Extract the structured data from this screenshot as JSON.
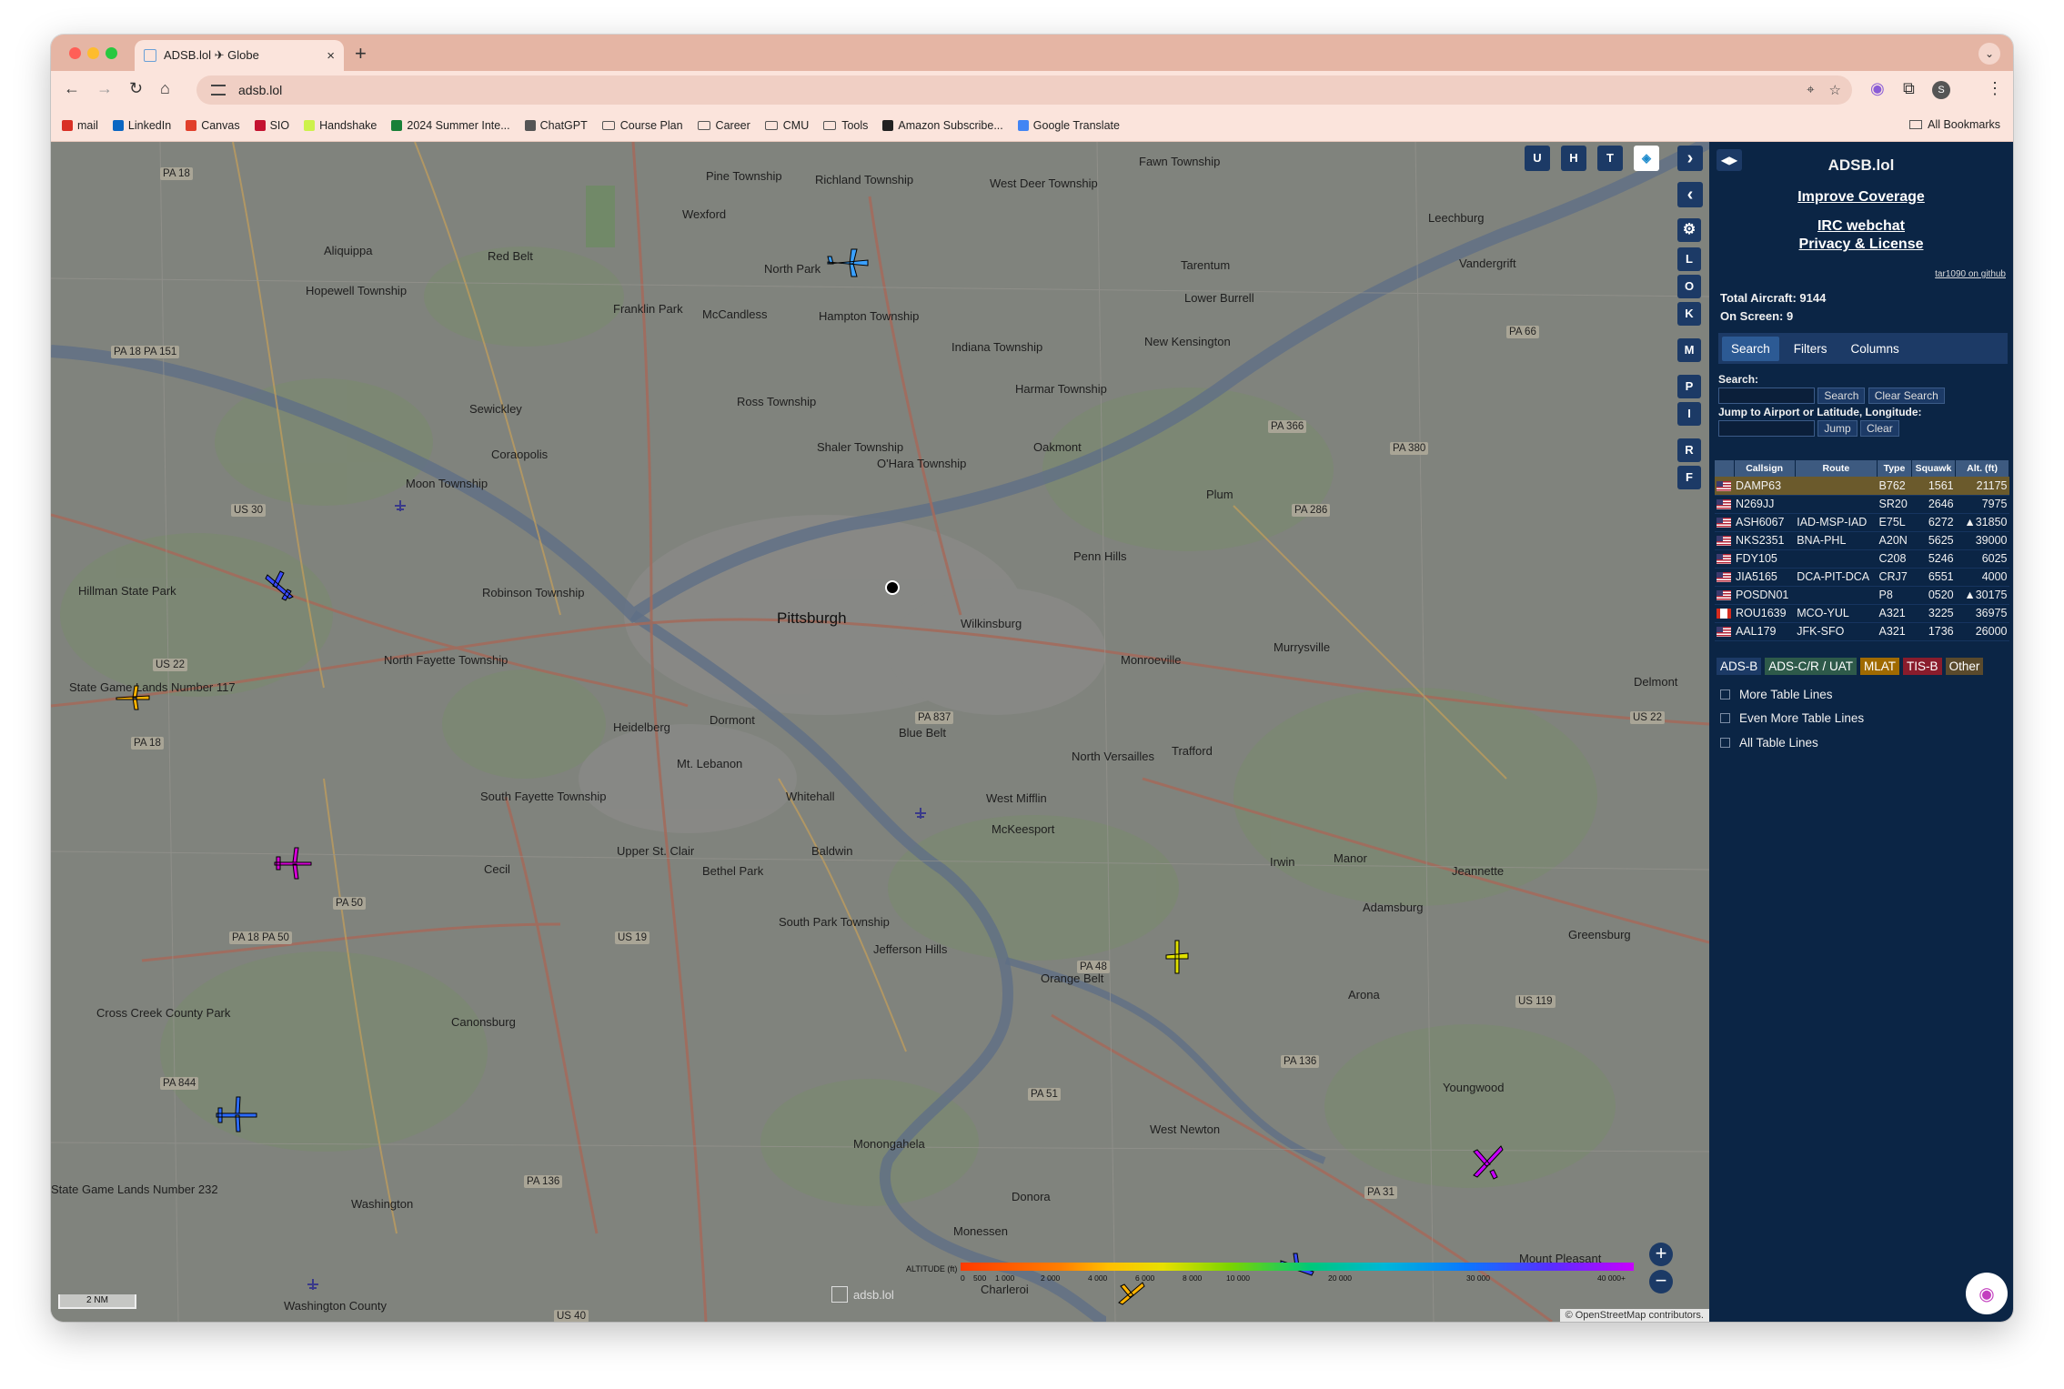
{
  "browser": {
    "tab_title": "ADSB.lol ✈ Globe",
    "tab_close": "×",
    "new_tab": "+",
    "url": "adsb.lol",
    "profile_initial": "S",
    "bookmarks": [
      {
        "label": "mail",
        "icon": "gmail-icon",
        "color": "#d93025"
      },
      {
        "label": "LinkedIn",
        "icon": "linkedin-icon",
        "color": "#0a66c2"
      },
      {
        "label": "Canvas",
        "icon": "canvas-icon",
        "color": "#e13f2b"
      },
      {
        "label": "SIO",
        "icon": "sio-icon",
        "color": "#c41230"
      },
      {
        "label": "Handshake",
        "icon": "handshake-icon",
        "color": "#cdf14a"
      },
      {
        "label": "2024 Summer Inte...",
        "icon": "sheets-icon",
        "color": "#188038"
      },
      {
        "label": "ChatGPT",
        "icon": "chatgpt-icon",
        "color": "#555555"
      },
      {
        "label": "Course Plan",
        "icon": "folder-icon",
        "color": ""
      },
      {
        "label": "Career",
        "icon": "folder-icon",
        "color": ""
      },
      {
        "label": "CMU",
        "icon": "folder-icon",
        "color": ""
      },
      {
        "label": "Tools",
        "icon": "folder-icon",
        "color": ""
      },
      {
        "label": "Amazon Subscribe...",
        "icon": "amazon-icon",
        "color": "#222222"
      },
      {
        "label": "Google Translate",
        "icon": "translate-icon",
        "color": "#4285f4"
      }
    ],
    "all_bookmarks": "All Bookmarks"
  },
  "map": {
    "top_buttons": [
      "U",
      "H",
      "T"
    ],
    "side_keys": [
      "L",
      "O",
      "K",
      "M",
      "P",
      "I",
      "R",
      "F"
    ],
    "labels": {
      "pittsburgh": "Pittsburgh",
      "places": [
        "Pine Township",
        "Richland Township",
        "West Deer Township",
        "Fawn Township",
        "Leechburg",
        "Wexford",
        "North Park",
        "Tarentum",
        "Vandergrift",
        "Aliquippa",
        "Red Belt",
        "Hopewell Township",
        "Franklin Park",
        "McCandless",
        "Hampton Township",
        "Lower Burrell",
        "Indiana Township",
        "New Kensington",
        "Harmar Township",
        "Ross Township",
        "Sewickley",
        "Coraopolis",
        "Shaler Township",
        "O'Hara Township",
        "Oakmont",
        "Moon Township",
        "Plum",
        "Penn Hills",
        "Hillman State Park",
        "Robinson Township",
        "Wilkinsburg",
        "Murrysville",
        "North Fayette Township",
        "Monroeville",
        "Delmont",
        "Heidelberg",
        "Dormont",
        "Mt. Lebanon",
        "Blue Belt",
        "North Versailles",
        "Trafford",
        "State Game Lands Number 117",
        "South Fayette Township",
        "Whitehall",
        "West Mifflin",
        "McKeesport",
        "Upper St. Clair",
        "Baldwin",
        "Bethel Park",
        "Irwin",
        "Manor",
        "Jeannette",
        "Cecil",
        "South Park Township",
        "Jefferson Hills",
        "Adamsburg",
        "Greensburg",
        "Orange Belt",
        "Cross Creek County Park",
        "Canonsburg",
        "Arona",
        "Youngwood",
        "West Newton",
        "Monongahela",
        "Washington",
        "Donora",
        "Monessen",
        "Charleroi",
        "Mount Pleasant",
        "State Game Lands Number 232",
        "Washington County"
      ],
      "routes": [
        "PA 18",
        "PA 18 PA 151",
        "US 30",
        "US 22",
        "PA 18",
        "PA 18 PA 50",
        "PA 50",
        "US 19",
        "PA 837",
        "PA 48",
        "PA 844",
        "PA 136",
        "US 40",
        "PA 51",
        "PA 136",
        "PA 31",
        "US 119",
        "US 22",
        "PA 66",
        "PA 366",
        "PA 380",
        "PA 286"
      ]
    },
    "legend": {
      "label": "ALTITUDE (ft)",
      "ticks": [
        "0",
        "500",
        "1 000",
        "2 000",
        "4 000",
        "6 000",
        "8 000",
        "10 000",
        "20 000",
        "30 000",
        "40 000+"
      ]
    },
    "scale": "2 NM",
    "watermark": "adsb.lol",
    "attribution": "© OpenStreetMap contributors.",
    "zoom_in": "+",
    "zoom_out": "−"
  },
  "panel": {
    "toggle": "◀▶",
    "title": "ADSB.lol",
    "links": [
      "Improve Coverage",
      "IRC webchat",
      "Privacy & License"
    ],
    "github": "tar1090 on github",
    "total_aircraft_label": "Total Aircraft:",
    "total_aircraft": "9144",
    "on_screen_label": "On Screen:",
    "on_screen": "9",
    "tabs": [
      "Search",
      "Filters",
      "Columns"
    ],
    "search_label": "Search:",
    "search_btn": "Search",
    "clear_search_btn": "Clear Search",
    "jump_label": "Jump to Airport or Latitude, Longitude:",
    "jump_btn": "Jump",
    "clear_btn": "Clear",
    "columns": [
      "Callsign",
      "Route",
      "Type",
      "Squawk",
      "Alt. (ft)"
    ],
    "rows": [
      {
        "flag": "us",
        "callsign": "DAMP63",
        "route": "",
        "type": "B762",
        "squawk": "1561",
        "alt": "21175",
        "selected": true
      },
      {
        "flag": "us",
        "callsign": "N269JJ",
        "route": "",
        "type": "SR20",
        "squawk": "2646",
        "alt": "7975"
      },
      {
        "flag": "us",
        "callsign": "ASH6067",
        "route": "IAD-MSP-IAD",
        "type": "E75L",
        "squawk": "6272",
        "alt": "▲31850"
      },
      {
        "flag": "us",
        "callsign": "NKS2351",
        "route": "BNA-PHL",
        "type": "A20N",
        "squawk": "5625",
        "alt": "39000"
      },
      {
        "flag": "us",
        "callsign": "FDY105",
        "route": "",
        "type": "C208",
        "squawk": "5246",
        "alt": "6025"
      },
      {
        "flag": "us",
        "callsign": "JIA5165",
        "route": "DCA-PIT-DCA",
        "type": "CRJ7",
        "squawk": "6551",
        "alt": "4000"
      },
      {
        "flag": "us",
        "callsign": "POSDN01",
        "route": "",
        "type": "P8",
        "squawk": "0520",
        "alt": "▲30175"
      },
      {
        "flag": "ca",
        "callsign": "ROU1639",
        "route": "MCO-YUL",
        "type": "A321",
        "squawk": "3225",
        "alt": "36975"
      },
      {
        "flag": "us",
        "callsign": "AAL179",
        "route": "JFK-SFO",
        "type": "A321",
        "squawk": "1736",
        "alt": "26000"
      }
    ],
    "sources": [
      {
        "label": "ADS-B",
        "color": "#1c3a66"
      },
      {
        "label": "ADS-C/R / UAT",
        "color": "#2e5a4a"
      },
      {
        "label": "MLAT",
        "color": "#a06a00"
      },
      {
        "label": "TIS-B",
        "color": "#8a1c2c"
      },
      {
        "label": "Other",
        "color": "#5a4a2c"
      }
    ],
    "options": [
      "More Table Lines",
      "Even More Table Lines",
      "All Table Lines"
    ]
  }
}
